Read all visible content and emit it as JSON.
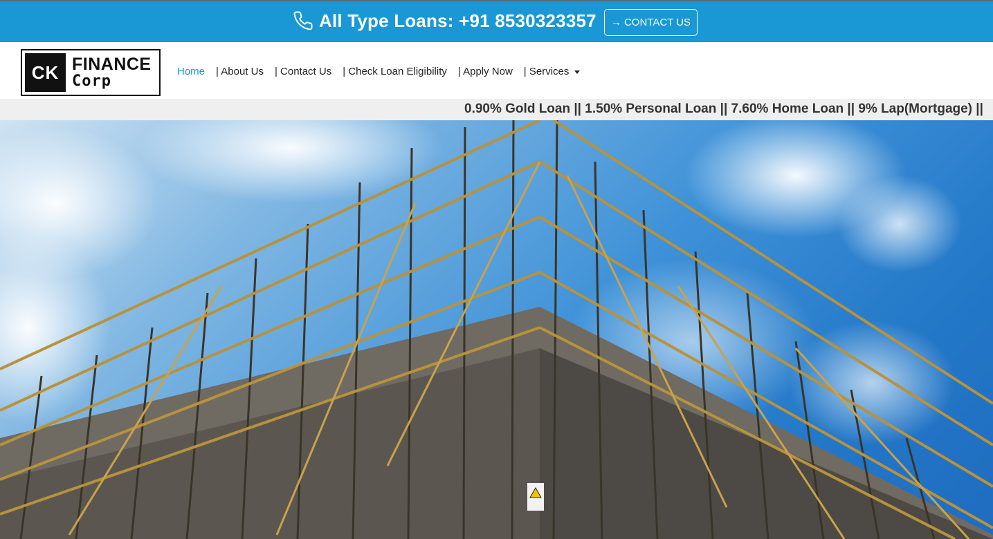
{
  "topbar": {
    "phone_icon": "phone-icon",
    "phone_text": "All Type Loans: +91 8530323357",
    "contact_button": {
      "icon": "arrow-right-icon",
      "label": "CONTACT US"
    },
    "background_color": "#1a98d5"
  },
  "logo": {
    "mark": "CK",
    "line1": "FINANCE",
    "line2": "Corp"
  },
  "nav": {
    "items": [
      {
        "label": "Home",
        "active": true
      },
      {
        "label": "| About Us"
      },
      {
        "label": "| Contact Us"
      },
      {
        "label": "| Check Loan Eligibility"
      },
      {
        "label": "| Apply Now"
      },
      {
        "label": "| Services",
        "dropdown": true
      }
    ],
    "active_color": "#1a98d5"
  },
  "ticker": {
    "text": "0.90% Gold Loan || 1.50% Personal Loan || 7.60% Home Loan || 9% Lap(Mortgage) ||"
  },
  "hero": {
    "image": "construction-scaffolding-building-under-blue-sky"
  }
}
